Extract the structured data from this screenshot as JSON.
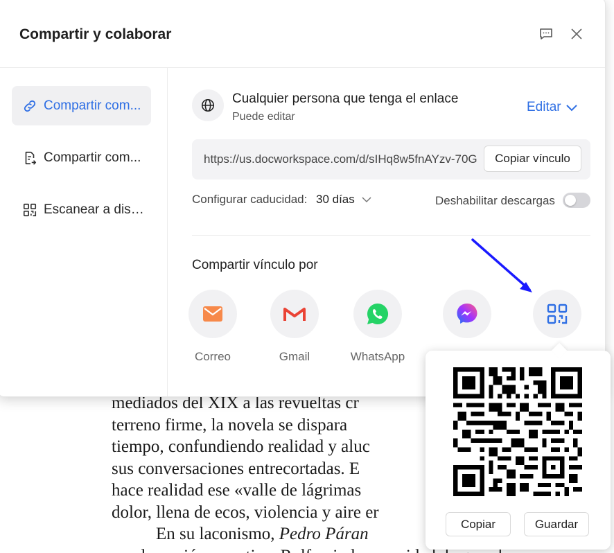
{
  "dialog": {
    "title": "Compartir y colaborar"
  },
  "sidebar": {
    "items": [
      {
        "label": "Compartir com...",
        "icon": "link-icon",
        "active": true
      },
      {
        "label": "Compartir com...",
        "icon": "document-share-icon",
        "active": false
      },
      {
        "label": "Escanear a disp...",
        "icon": "qr-code-icon",
        "active": false
      }
    ]
  },
  "access": {
    "title": "Cualquier persona que tenga el enlace",
    "subtitle": "Puede editar",
    "edit_label": "Editar"
  },
  "link": {
    "url": "https://us.docworkspace.com/d/sIHq8w5fnAYzv-70G",
    "copy_label": "Copiar vínculo"
  },
  "expiry": {
    "label": "Configurar caducidad:",
    "value": "30 días"
  },
  "downloads": {
    "label": "Deshabilitar descargas",
    "enabled": false
  },
  "share": {
    "title": "Compartir vínculo por",
    "options": [
      {
        "label": "Correo",
        "icon": "mail-icon"
      },
      {
        "label": "Gmail",
        "icon": "gmail-icon"
      },
      {
        "label": "WhatsApp",
        "icon": "whatsapp-icon"
      },
      {
        "label": "",
        "icon": "messenger-icon"
      },
      {
        "label": "",
        "icon": "qr-code-icon"
      }
    ]
  },
  "qr_popup": {
    "copy_label": "Copiar",
    "save_label": "Guardar"
  },
  "document": {
    "lines": [
      "mediados del XIX a las revueltas cr",
      "terreno firme, la novela se dispara",
      "tiempo, confundiendo realidad y aluc",
      "sus conversaciones entrecortadas. E",
      "hace realidad ese «valle de lágrimas",
      "dolor, llena de ecos, violencia y aire er"
    ],
    "para_start": "En su laconismo, ",
    "para_italic": "Pedro Páran",
    "last_line": "condensación narrativa. Rulfo vio la necesidad de que el"
  },
  "colors": {
    "accent": "#2f6fe4",
    "annotation_arrow": "#1a1aff",
    "mail": "#f7894a",
    "gmail": "#ea4335",
    "whatsapp": "#25d366",
    "messenger": "#a033ff"
  }
}
